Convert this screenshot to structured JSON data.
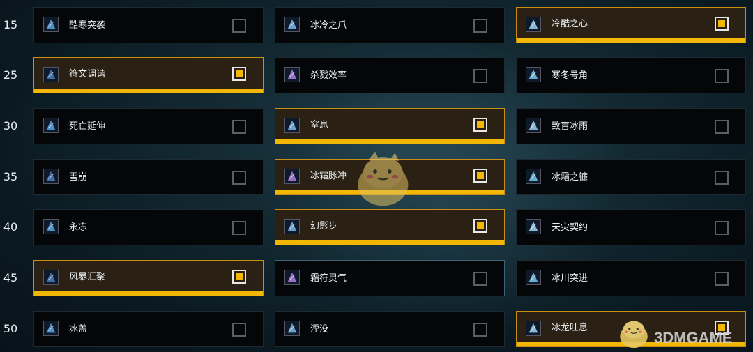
{
  "watermark": "3DMGAME",
  "colors": {
    "selected_bg": "#2a2114",
    "accent": "#f2b705",
    "card_bg": "#040608"
  },
  "rows": [
    {
      "level": "15",
      "talents": [
        {
          "name": "酷寒突袭",
          "icon": "frost-strike-icon",
          "selected": false
        },
        {
          "name": "冰冷之爪",
          "icon": "icy-talons-icon",
          "selected": false
        },
        {
          "name": "冷酷之心",
          "icon": "cold-heart-icon",
          "selected": true
        }
      ]
    },
    {
      "level": "25",
      "talents": [
        {
          "name": "符文调谐",
          "icon": "runic-attenuation-icon",
          "selected": true
        },
        {
          "name": "杀戮效率",
          "icon": "murderous-efficiency-icon",
          "selected": false
        },
        {
          "name": "寒冬号角",
          "icon": "horn-of-winter-icon",
          "selected": false
        }
      ]
    },
    {
      "level": "30",
      "talents": [
        {
          "name": "死亡延伸",
          "icon": "deaths-reach-icon",
          "selected": false
        },
        {
          "name": "窒息",
          "icon": "asphyxiate-icon",
          "selected": true
        },
        {
          "name": "致盲冰雨",
          "icon": "blinding-sleet-icon",
          "selected": false
        }
      ]
    },
    {
      "level": "35",
      "talents": [
        {
          "name": "雪崩",
          "icon": "avalanche-icon",
          "selected": false
        },
        {
          "name": "冰霜脉冲",
          "icon": "frozen-pulse-icon",
          "selected": true
        },
        {
          "name": "冰霜之镰",
          "icon": "frostscythe-icon",
          "selected": false
        }
      ]
    },
    {
      "level": "40",
      "talents": [
        {
          "name": "永冻",
          "icon": "permafrost-icon",
          "selected": false
        },
        {
          "name": "幻影步",
          "icon": "wraith-walk-icon",
          "selected": true
        },
        {
          "name": "天灾契约",
          "icon": "death-pact-icon",
          "selected": false
        }
      ]
    },
    {
      "level": "45",
      "talents": [
        {
          "name": "风暴汇聚",
          "icon": "gathering-storm-icon",
          "selected": true
        },
        {
          "name": "霜符灵气",
          "icon": "glacial-advance-icon",
          "selected": false,
          "hovered": true
        },
        {
          "name": "冰川突进",
          "icon": "icecap-icon",
          "selected": false
        }
      ]
    },
    {
      "level": "50",
      "talents": [
        {
          "name": "冰盖",
          "icon": "icecap-ring-icon",
          "selected": false
        },
        {
          "name": "湮没",
          "icon": "obliteration-icon",
          "selected": false
        },
        {
          "name": "冰龙吐息",
          "icon": "breath-of-sindragosa-icon",
          "selected": true
        }
      ]
    }
  ]
}
